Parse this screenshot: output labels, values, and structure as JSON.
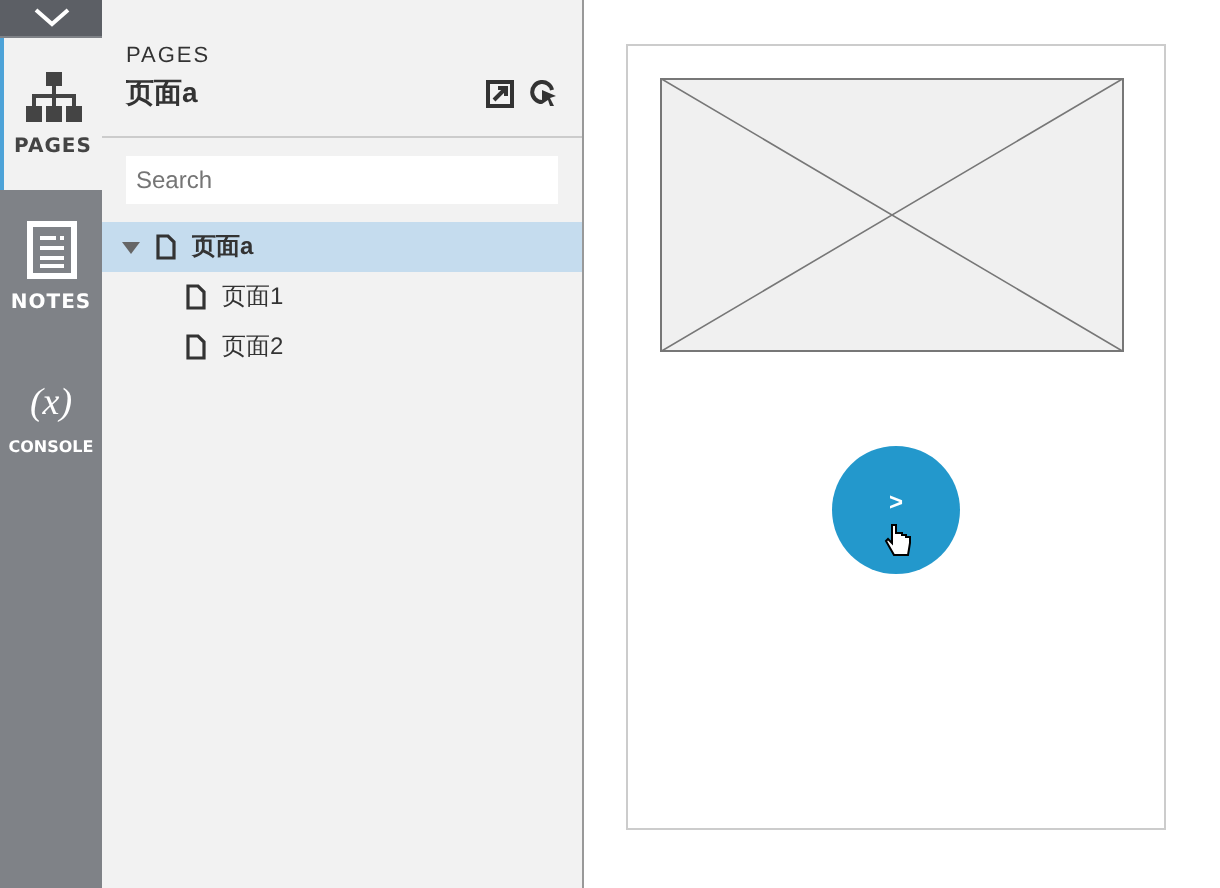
{
  "rail": {
    "tabs": [
      {
        "label": "PAGES",
        "kind": "sitemap",
        "selected": true
      },
      {
        "label": "NOTES",
        "kind": "notes",
        "selected": false
      },
      {
        "label": "CONSOLE",
        "kind": "console",
        "glyph": "(x)",
        "selected": false
      }
    ]
  },
  "panel": {
    "heading": "PAGES",
    "title": "页面a",
    "search": {
      "placeholder": "Search"
    },
    "tree": [
      {
        "label": "页面a",
        "selected": true,
        "expanded": true,
        "children": [
          {
            "label": "页面1",
            "selected": false
          },
          {
            "label": "页面2",
            "selected": false
          }
        ]
      }
    ]
  },
  "canvas": {
    "button": {
      "label": ">"
    }
  }
}
